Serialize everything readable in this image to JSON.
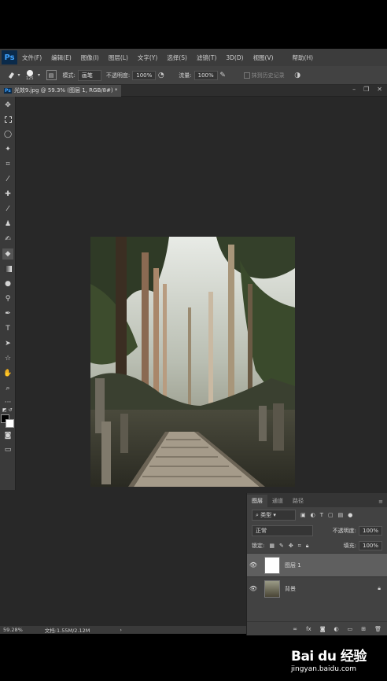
{
  "menubar": {
    "logo": "Ps",
    "items": [
      "文件(F)",
      "编辑(E)",
      "图像(I)",
      "图层(L)",
      "文字(Y)",
      "选择(S)",
      "滤镜(T)",
      "3D(D)",
      "视图(V)",
      "",
      "帮助(H)"
    ]
  },
  "optbar": {
    "brush_size": "125",
    "mode_label": "模式:",
    "mode_value": "画笔",
    "opacity_label": "不透明度:",
    "opacity_value": "100%",
    "flow_label": "流量:",
    "flow_value": "100%",
    "history_label": "抹到历史记录"
  },
  "doctab": {
    "ps": "Ps",
    "title": "光效9.jpg @ 59.3% (图层 1, RGB/8#) *"
  },
  "layers": {
    "tabs": [
      "图层",
      "通道",
      "路径"
    ],
    "filter_label": "类型",
    "blend_mode": "正常",
    "opacity_label": "不透明度:",
    "opacity_value": "100%",
    "lock_label": "锁定:",
    "fill_label": "填充:",
    "fill_value": "100%",
    "items": [
      {
        "name": "图层 1"
      },
      {
        "name": "背景"
      }
    ]
  },
  "status": {
    "zoom": "59.28%",
    "doc": "文档:1.55M/2.12M"
  },
  "watermark": {
    "brand": "Bai du 经验",
    "url": "jingyan.baidu.com"
  },
  "colors": {
    "bg": "#282828",
    "panel": "#424242",
    "accent": "#3fa3ff"
  }
}
